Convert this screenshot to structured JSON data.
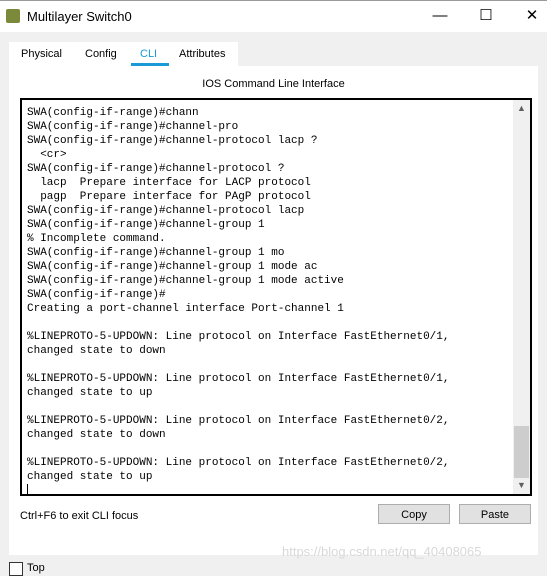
{
  "window": {
    "title": "Multilayer Switch0",
    "minimize": "—",
    "maximize": "☐",
    "close": "✕"
  },
  "tabs": [
    {
      "label": "Physical"
    },
    {
      "label": "Config"
    },
    {
      "label": "CLI",
      "active": true
    },
    {
      "label": "Attributes"
    }
  ],
  "accent": "#1a9ad6",
  "cli": {
    "heading": "IOS Command Line Interface",
    "lines": [
      "SWA(config-if-range)#chann",
      "SWA(config-if-range)#channel-pro",
      "SWA(config-if-range)#channel-protocol lacp ?",
      "  <cr>",
      "SWA(config-if-range)#channel-protocol ?",
      "  lacp  Prepare interface for LACP protocol",
      "  pagp  Prepare interface for PAgP protocol",
      "SWA(config-if-range)#channel-protocol lacp",
      "SWA(config-if-range)#channel-group 1",
      "% Incomplete command.",
      "SWA(config-if-range)#channel-group 1 mo",
      "SWA(config-if-range)#channel-group 1 mode ac",
      "SWA(config-if-range)#channel-group 1 mode active",
      "SWA(config-if-range)#",
      "Creating a port-channel interface Port-channel 1",
      "",
      "%LINEPROTO-5-UPDOWN: Line protocol on Interface FastEthernet0/1,",
      "changed state to down",
      "",
      "%LINEPROTO-5-UPDOWN: Line protocol on Interface FastEthernet0/1,",
      "changed state to up",
      "",
      "%LINEPROTO-5-UPDOWN: Line protocol on Interface FastEthernet0/2,",
      "changed state to down",
      "",
      "%LINEPROTO-5-UPDOWN: Line protocol on Interface FastEthernet0/2,",
      "changed state to up"
    ],
    "hint": "Ctrl+F6 to exit CLI focus",
    "copy_label": "Copy",
    "paste_label": "Paste"
  },
  "watermark": "https://blog.csdn.net/qq_40408065",
  "top_checkbox": {
    "label": "Top",
    "checked": false
  }
}
